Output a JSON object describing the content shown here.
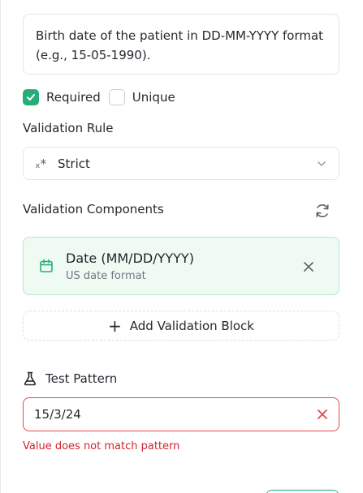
{
  "description": {
    "text": "Birth date of the patient in DD-MM-YYYY format (e.g., 15-05-1990)."
  },
  "flags": {
    "required_label": "Required",
    "required_checked": true,
    "unique_label": "Unique",
    "unique_checked": false
  },
  "validation_rule": {
    "label": "Validation Rule",
    "icon": "regex-icon",
    "icon_glyph": "ₓ*",
    "selected": "Strict"
  },
  "components": {
    "label": "Validation Components",
    "items": [
      {
        "icon": "calendar-icon",
        "title": "Date (MM/DD/YYYY)",
        "subtitle": "US date format"
      }
    ],
    "add_label": "Add Validation Block"
  },
  "test_pattern": {
    "label": "Test Pattern",
    "value": "15/3/24",
    "error": "Value does not match pattern"
  },
  "colors": {
    "accent": "#27ae78",
    "card_bg": "#effaf3",
    "error": "#d1242f"
  }
}
